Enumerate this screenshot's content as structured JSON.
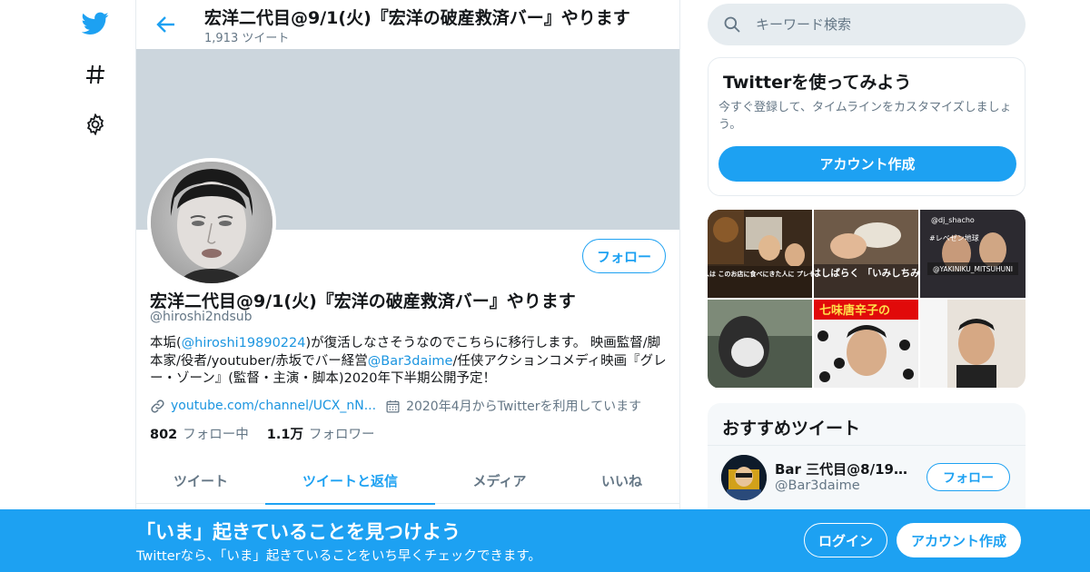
{
  "nav": {
    "icons": [
      "twitter-logo-icon",
      "hashtag-icon",
      "gear-icon"
    ],
    "brand_color": "#1da1f2"
  },
  "header": {
    "title": "宏洋二代目@9/1(火)『宏洋の破産救済バー』やります",
    "tweet_count": "1,913 ツイート"
  },
  "profile": {
    "name": "宏洋二代目@9/1(火)『宏洋の破産救済バー』やります",
    "handle": "@hiroshi2ndsub",
    "follow_label": "フォロー",
    "bio": {
      "p1": "本垢(",
      "mention1": "@hiroshi19890224",
      "p2": ")が復活しなさそうなのでこちらに移行します。 映画監督/脚本家/役者/youtuber/赤坂でバー経営",
      "mention2": "@Bar3daime",
      "p3": "/任侠アクションコメディ映画『グレー・ゾーン』(監督・主演・脚本)2020年下半期公開予定！"
    },
    "website": "youtube.com/channel/UCX_nN...",
    "joined": "2020年4月からTwitterを利用しています",
    "following_count": "802",
    "following_label": "フォロー中",
    "followers_count": "1.1万",
    "followers_label": "フォロワー"
  },
  "tabs": [
    {
      "label": "ツイート",
      "active": false
    },
    {
      "label": "ツイートと返信",
      "active": true
    },
    {
      "label": "メディア",
      "active": false
    },
    {
      "label": "いいね",
      "active": false
    }
  ],
  "search": {
    "placeholder": "キーワード検索"
  },
  "signup_card": {
    "title": "Twitterを使ってみよう",
    "description": "今すぐ登録して、タイムラインをカスタマイズしましょう。",
    "button": "アカウント作成"
  },
  "media": {
    "captions": [
      "この七味欲しい人は このお店に食べにきた人に プレゼントするらしい",
      "この店ではしばらく 「いみしちみ」使い放",
      "@dj_shacho",
      "@YAKINIKU_MITSUHUNI",
      "七味唐辛子の",
      "#レベゼン地球"
    ]
  },
  "recommended": {
    "title": "おすすめツイート",
    "user_name": "Bar 三代目@8/19し…",
    "user_handle": "@Bar3daime",
    "follow_label": "フォロー"
  },
  "bottom_bar": {
    "title": "「いま」起きていることを見つけよう",
    "subtitle": "Twitterなら、「いま」起きていることをいち早くチェックできます。",
    "login": "ログイン",
    "signup": "アカウント作成"
  }
}
